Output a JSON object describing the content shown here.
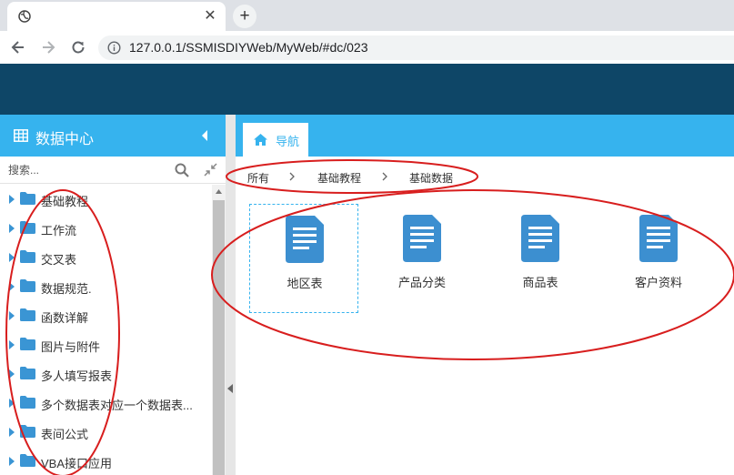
{
  "browser": {
    "url": "127.0.0.1/SSMISDIYWeb/MyWeb/#dc/023",
    "new_tab_symbol": "+",
    "close_symbol": "✕"
  },
  "sidebar": {
    "title": "数据中心",
    "search_placeholder": "搜索...",
    "items": [
      {
        "label": "基础教程"
      },
      {
        "label": "工作流"
      },
      {
        "label": "交叉表"
      },
      {
        "label": "数据规范."
      },
      {
        "label": "函数详解"
      },
      {
        "label": "图片与附件"
      },
      {
        "label": "多人填写报表"
      },
      {
        "label": "多个数据表对应一个数据表..."
      },
      {
        "label": "表间公式"
      },
      {
        "label": "VBA接口应用"
      }
    ]
  },
  "main": {
    "tab_label": "导航",
    "breadcrumb": [
      "所有",
      "基础教程",
      "基础数据"
    ],
    "tiles": [
      {
        "label": "地区表",
        "selected": true
      },
      {
        "label": "产品分类",
        "selected": false
      },
      {
        "label": "商品表",
        "selected": false
      },
      {
        "label": "客户资料",
        "selected": false
      }
    ]
  },
  "colors": {
    "header": "#0e4667",
    "accent": "#36b3ee",
    "doc_icon": "#3c8fd0",
    "annotation": "#d81e1e"
  },
  "icons": {
    "sidebar_head": "grid-table-icon",
    "folder": "folder-icon",
    "tile": "document-icon",
    "tab": "home-icon"
  }
}
